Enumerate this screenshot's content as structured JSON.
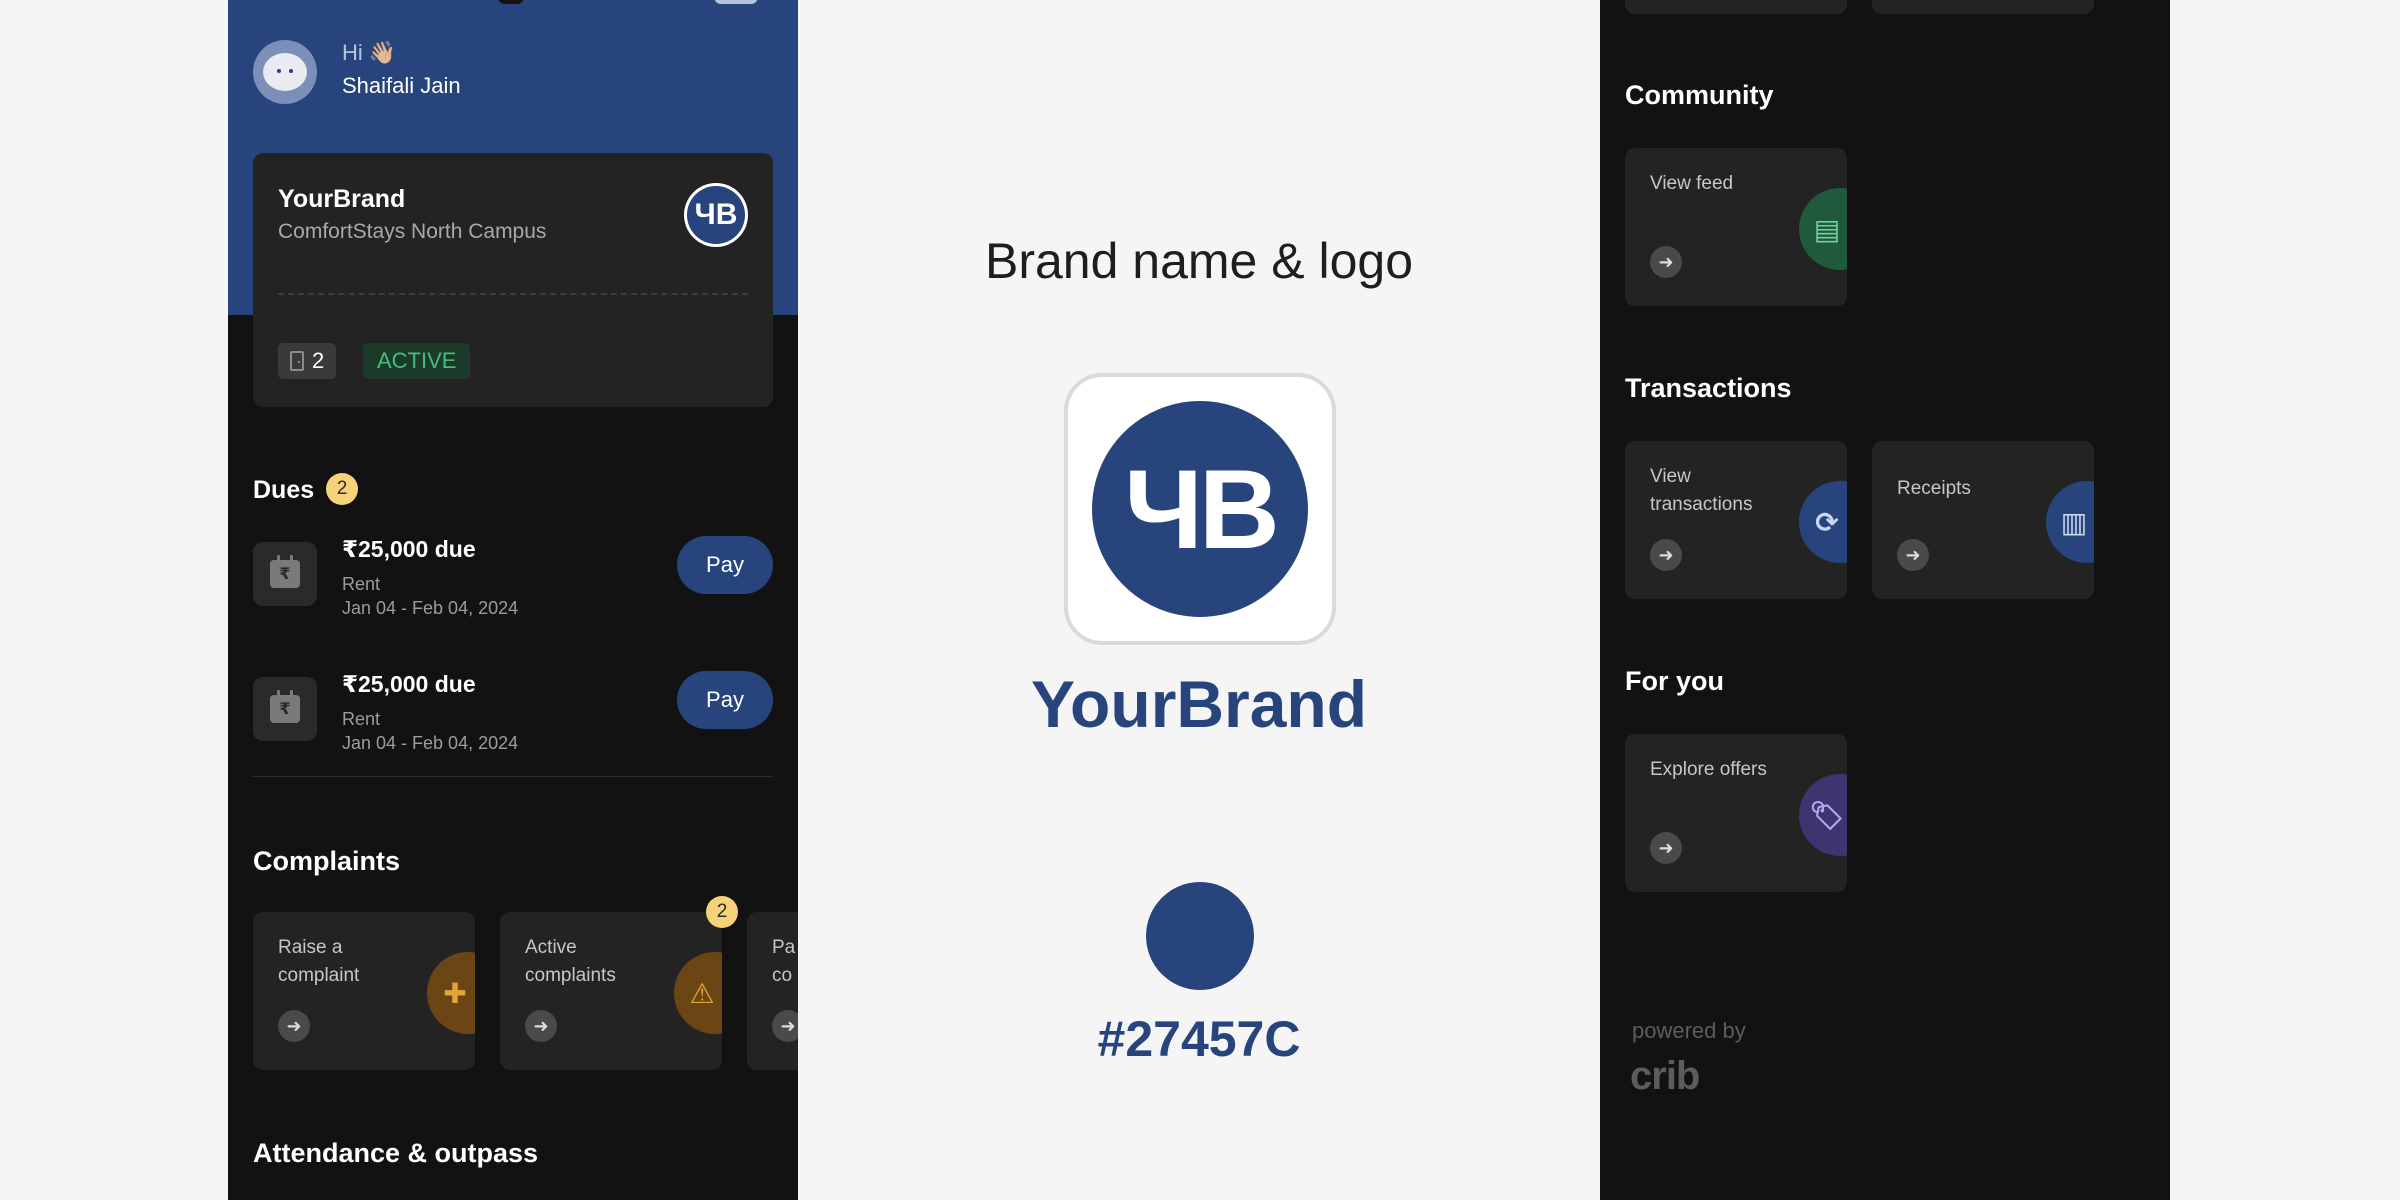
{
  "left_phone": {
    "greeting": {
      "hi": "Hi 👋🏼",
      "name": "Shaifali Jain"
    },
    "property": {
      "brand": "YourBrand",
      "campus": "ComfortStays North Campus",
      "logo_text": "ЧB",
      "room_count": "2",
      "status": "ACTIVE"
    },
    "dues": {
      "title": "Dues",
      "count": "2",
      "items": [
        {
          "amount": "₹25,000 due",
          "type": "Rent",
          "dates": "Jan 04 - Feb 04, 2024",
          "action": "Pay",
          "icon": "calendar-rupee-icon"
        },
        {
          "amount": "₹25,000 due",
          "type": "Rent",
          "dates": "Jan 04 - Feb 04, 2024",
          "action": "Pay",
          "icon": "calendar-rupee-icon"
        }
      ]
    },
    "complaints": {
      "title": "Complaints",
      "tiles": [
        {
          "label_line1": "Raise a",
          "label_line2": "complaint",
          "icon": "plus-3d-icon",
          "icon_bg": "#6b4514",
          "icon_color": "#e0a437"
        },
        {
          "label_line1": "Active",
          "label_line2": "complaints",
          "icon": "warning-3d-icon",
          "icon_bg": "#6b4514",
          "icon_color": "#e0a437",
          "badge": "2"
        },
        {
          "label_line1": "Pa",
          "label_line2": "co",
          "icon": "arrow-icon"
        }
      ]
    },
    "attendance_title": "Attendance & outpass"
  },
  "brand_panel": {
    "heading": "Brand name & logo",
    "logo_text": "ЧB",
    "wordmark": "YourBrand",
    "color_hex": "#27457C",
    "swatch_color": "#27457c"
  },
  "right_phone": {
    "community": {
      "title": "Community",
      "tiles": [
        {
          "label_line1": "View feed",
          "label_line2": "",
          "icon": "feed-3d-icon",
          "icon_bg": "#1f5a3d",
          "icon_color": "#6fd39b"
        }
      ]
    },
    "transactions": {
      "title": "Transactions",
      "tiles": [
        {
          "label_line1": "View",
          "label_line2": "transactions",
          "icon": "refresh-3d-icon",
          "icon_bg": "#27457c",
          "icon_color": "#c9d6f0"
        },
        {
          "label_line1": "Receipts",
          "label_line2": "",
          "icon": "receipt-3d-icon",
          "icon_bg": "#27457c",
          "icon_color": "#c9d6f0"
        }
      ]
    },
    "for_you": {
      "title": "For you",
      "tiles": [
        {
          "label_line1": "Explore offers",
          "label_line2": "",
          "icon": "tag-3d-icon",
          "icon_bg": "#3e3470",
          "icon_color": "#b5a8f0"
        }
      ]
    },
    "powered_by": "powered by",
    "crib_logo": "crib"
  },
  "colors": {
    "brand": "#27457c",
    "background_dark": "#121212",
    "card": "#232323",
    "success": "#3fbf7a",
    "badge": "#f6d27a"
  }
}
